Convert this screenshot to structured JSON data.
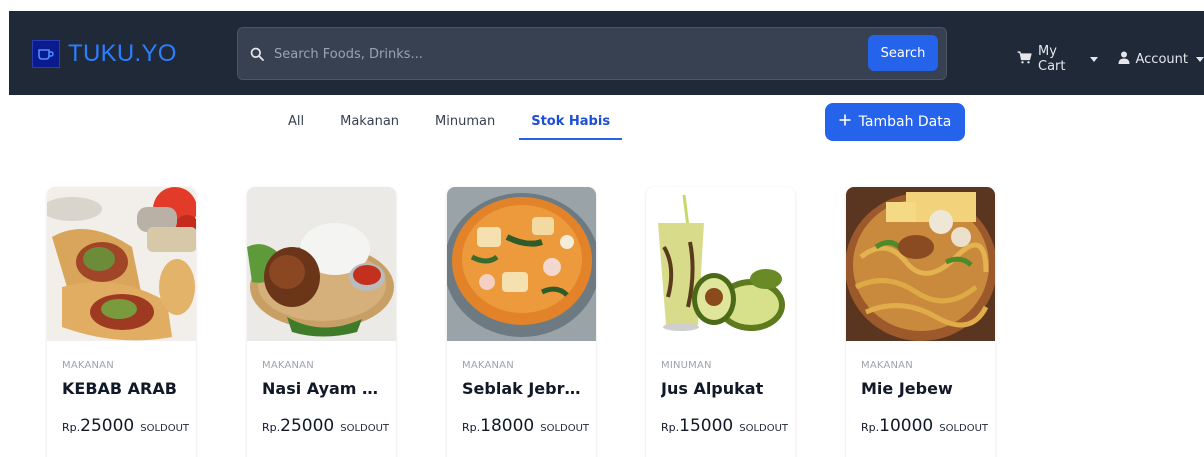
{
  "brand": {
    "name": "TUKU.YO",
    "icon": "cup-icon"
  },
  "search": {
    "placeholder": "Search Foods, Drinks...",
    "button_label": "Search"
  },
  "nav": {
    "cart_label": "My Cart",
    "account_label": "Account"
  },
  "tabs": [
    {
      "label": "All"
    },
    {
      "label": "Makanan"
    },
    {
      "label": "Minuman"
    },
    {
      "label": "Stok Habis",
      "active": true
    }
  ],
  "add_button": {
    "label": "Tambah Data"
  },
  "products": [
    {
      "category": "MAKANAN",
      "name": "KEBAB ARAB",
      "currency": "Rp.",
      "price": "25000",
      "status": "SOLDOUT"
    },
    {
      "category": "MAKANAN",
      "name": "Nasi Ayam Bakar",
      "currency": "Rp.",
      "price": "25000",
      "status": "SOLDOUT"
    },
    {
      "category": "MAKANAN",
      "name": "Seblak Jebret",
      "currency": "Rp.",
      "price": "18000",
      "status": "SOLDOUT"
    },
    {
      "category": "MINUMAN",
      "name": "Jus Alpukat",
      "currency": "Rp.",
      "price": "15000",
      "status": "SOLDOUT"
    },
    {
      "category": "MAKANAN",
      "name": "Mie Jebew",
      "currency": "Rp.",
      "price": "10000",
      "status": "SOLDOUT"
    }
  ],
  "colors": {
    "navbar": "#1f2937",
    "primary": "#2563eb",
    "brand": "#2b7fff"
  }
}
